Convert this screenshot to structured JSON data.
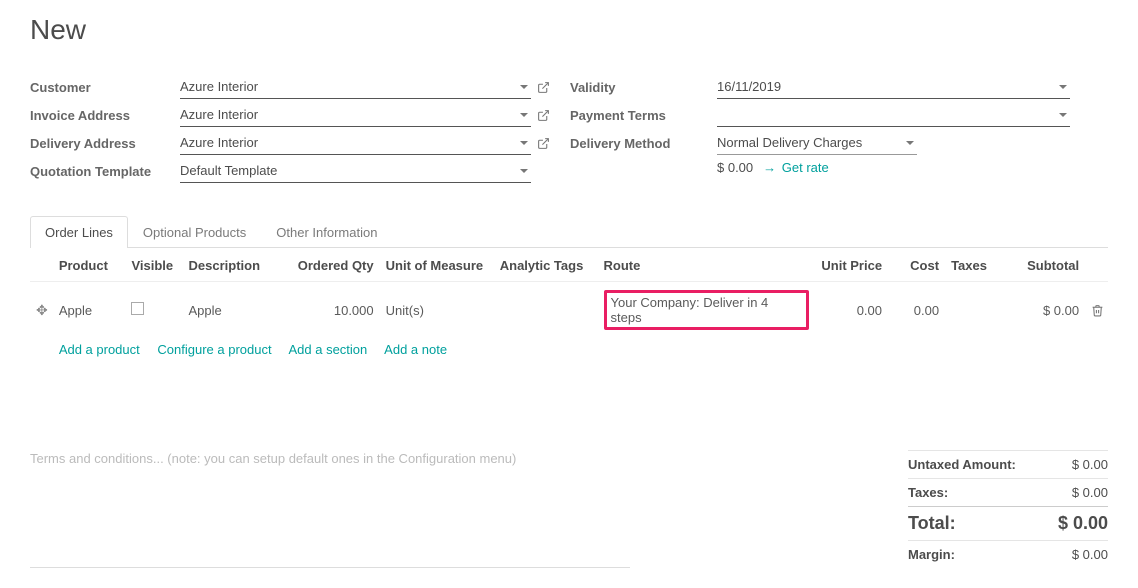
{
  "title": "New",
  "labels": {
    "customer": "Customer",
    "invoice_address": "Invoice Address",
    "delivery_address": "Delivery Address",
    "quotation_template": "Quotation Template",
    "validity": "Validity",
    "payment_terms": "Payment Terms",
    "delivery_method": "Delivery Method",
    "get_rate": "Get rate"
  },
  "fields": {
    "customer": "Azure Interior",
    "invoice_address": "Azure Interior",
    "delivery_address": "Azure Interior",
    "quotation_template": "Default Template",
    "validity": "16/11/2019",
    "payment_terms": "",
    "delivery_method": "Normal Delivery Charges",
    "delivery_cost": "$ 0.00"
  },
  "tabs": [
    "Order Lines",
    "Optional Products",
    "Other Information"
  ],
  "active_tab": 0,
  "columns": {
    "product": "Product",
    "visible": "Visible",
    "description": "Description",
    "ordered_qty": "Ordered Qty",
    "uom": "Unit of Measure",
    "analytic_tags": "Analytic Tags",
    "route": "Route",
    "unit_price": "Unit Price",
    "cost": "Cost",
    "taxes": "Taxes",
    "subtotal": "Subtotal"
  },
  "rows": [
    {
      "product": "Apple",
      "visible": false,
      "description": "Apple",
      "ordered_qty": "10.000",
      "uom": "Unit(s)",
      "analytic_tags": "",
      "route": "Your Company: Deliver in 4 steps",
      "unit_price": "0.00",
      "cost": "0.00",
      "taxes": "",
      "subtotal": "$ 0.00"
    }
  ],
  "line_actions": {
    "add_product": "Add a product",
    "configure_product": "Configure a product",
    "add_section": "Add a section",
    "add_note": "Add a note"
  },
  "terms_placeholder": "Terms and conditions... (note: you can setup default ones in the Configuration menu)",
  "totals": {
    "untaxed_label": "Untaxed Amount:",
    "untaxed_value": "$ 0.00",
    "taxes_label": "Taxes:",
    "taxes_value": "$ 0.00",
    "total_label": "Total:",
    "total_value": "$ 0.00",
    "margin_label": "Margin:",
    "margin_value": "$ 0.00"
  }
}
